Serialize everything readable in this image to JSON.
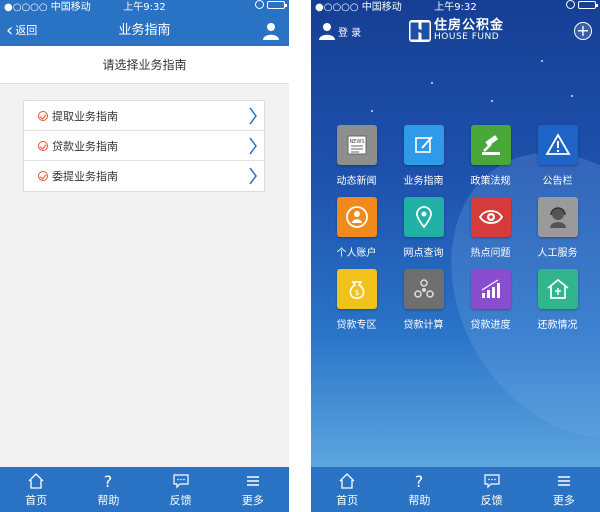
{
  "status": {
    "carrier": "●○○○○ 中国移动",
    "time": "上午9:32"
  },
  "left": {
    "nav": {
      "back_label": "返回",
      "title": "业务指南"
    },
    "subheader": "请选择业务指南",
    "items": [
      {
        "label": "提取业务指南"
      },
      {
        "label": "贷款业务指南"
      },
      {
        "label": "委提业务指南"
      }
    ]
  },
  "right": {
    "login_label": "登 录",
    "logo": {
      "cn": "住房公积金",
      "en": "HOUSE FUND"
    },
    "grid": [
      {
        "label": "动态新闻",
        "color": "#8e8e8e",
        "icon": "news-icon"
      },
      {
        "label": "业务指南",
        "color": "#2f9be8",
        "icon": "edit-icon"
      },
      {
        "label": "政策法规",
        "color": "#4aa83a",
        "icon": "gavel-icon"
      },
      {
        "label": "公告栏",
        "color": "#1f63c6",
        "icon": "warning-icon"
      },
      {
        "label": "个人账户",
        "color": "#f08a1c",
        "icon": "person-icon"
      },
      {
        "label": "网点查询",
        "color": "#20b0a6",
        "icon": "location-icon"
      },
      {
        "label": "热点问题",
        "color": "#d63b3b",
        "icon": "eye-icon"
      },
      {
        "label": "人工服务",
        "color": "#9a9a9a",
        "icon": "agent-icon"
      },
      {
        "label": "贷款专区",
        "color": "#f2c21c",
        "icon": "moneybag-icon"
      },
      {
        "label": "贷款计算",
        "color": "#6f6f6f",
        "icon": "calculator-icon"
      },
      {
        "label": "贷款进度",
        "color": "#8a4dd0",
        "icon": "progress-chart-icon"
      },
      {
        "label": "还款情况",
        "color": "#31b58c",
        "icon": "house-icon"
      }
    ]
  },
  "tabbar": [
    {
      "label": "首页",
      "icon": "home-icon"
    },
    {
      "label": "帮助",
      "icon": "help-icon"
    },
    {
      "label": "反馈",
      "icon": "feedback-icon"
    },
    {
      "label": "更多",
      "icon": "more-icon"
    }
  ]
}
